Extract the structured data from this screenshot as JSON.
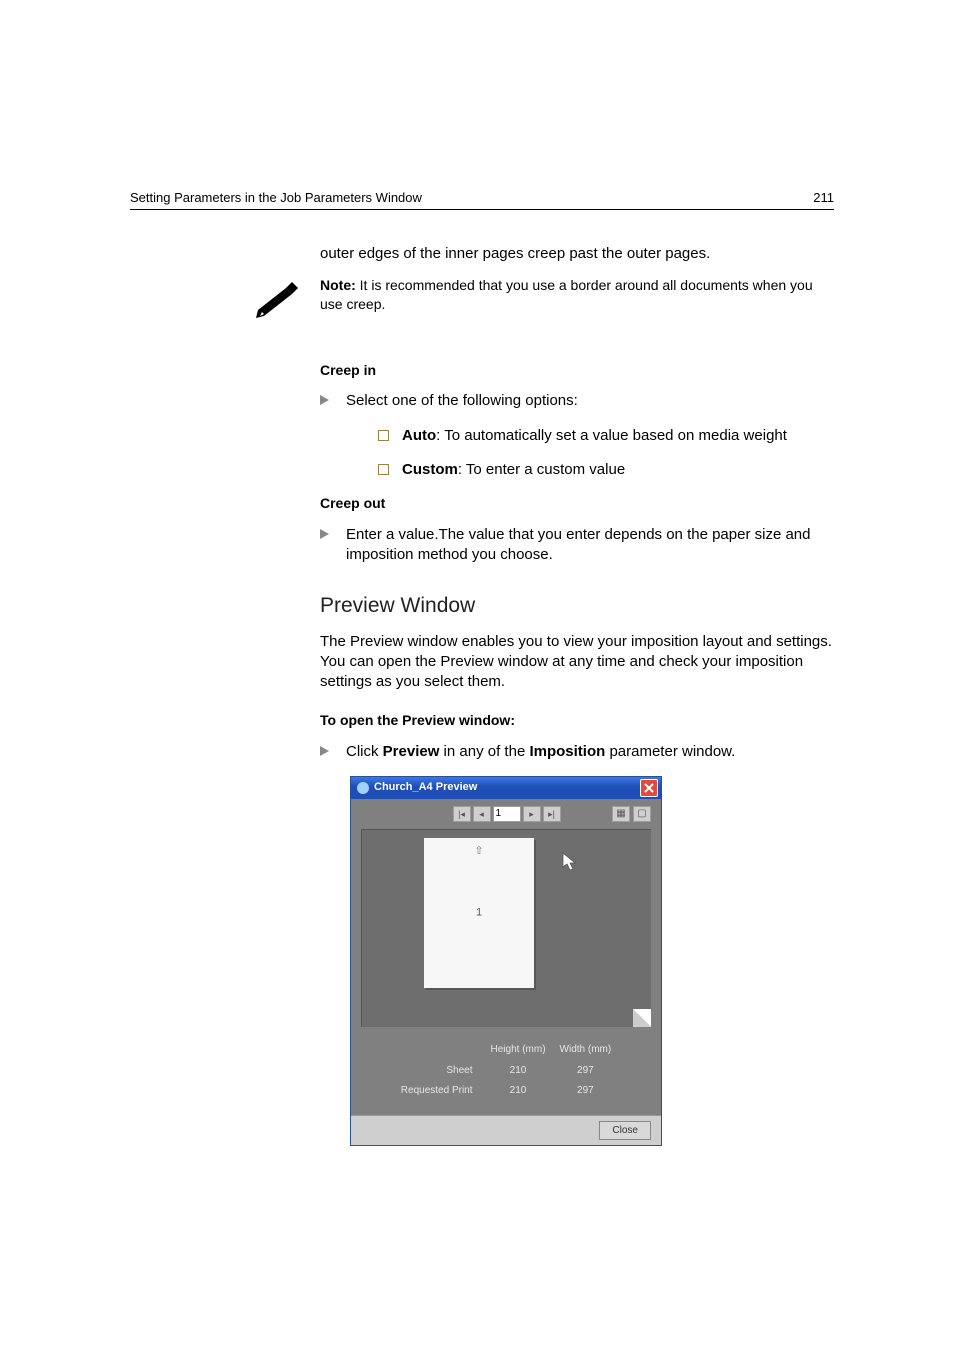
{
  "header": {
    "title": "Setting Parameters in the Job Parameters Window",
    "page_number": "211"
  },
  "orphan_line": "outer edges of the inner pages creep past the outer pages.",
  "note": {
    "label": "Note:",
    "text": "  It is recommended that you use a border around all documents when you use creep."
  },
  "creep_in": {
    "heading": "Creep in",
    "select_line": "Select one of the following options:",
    "auto_label": "Auto",
    "auto_text": ": To automatically set a value based on media weight",
    "custom_label": "Custom",
    "custom_text": ": To enter a custom value"
  },
  "creep_out": {
    "heading": "Creep out",
    "text": "Enter a value.The value that you enter depends on the paper size and imposition method you choose."
  },
  "preview": {
    "heading": "Preview Window",
    "para": "The Preview window enables you to view your imposition layout and settings. You can open the Preview window at any time and check your imposition settings as you select them.",
    "open_heading": "To open the Preview window:",
    "click_prefix": "Click ",
    "click_b1": "Preview",
    "click_mid": " in any of the ",
    "click_b2": "Imposition",
    "click_suffix": " parameter window."
  },
  "window": {
    "title": "Church_A4 Preview",
    "page_field": "1",
    "sheet_number": "1",
    "dims": {
      "col1": "Height (mm)",
      "col2": "Width (mm)",
      "row1_label": "Sheet",
      "row1_h": "210",
      "row1_w": "297",
      "row2_label": "Requested Print",
      "row2_h": "210",
      "row2_w": "297"
    },
    "close": "Close"
  }
}
